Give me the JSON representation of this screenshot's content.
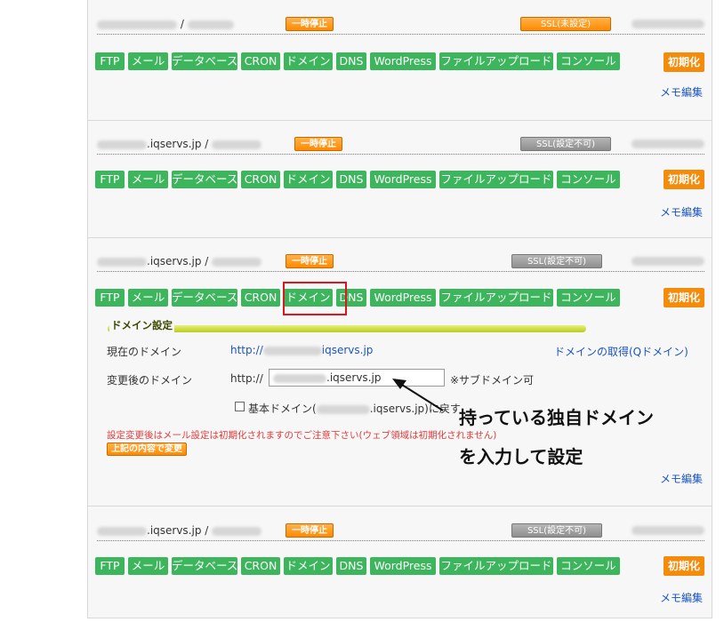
{
  "servers": [
    {
      "host_suffix": "",
      "pause": "一時停止",
      "ssl": "SSL(未設定)",
      "ssl_style": "orange"
    },
    {
      "host_suffix": ".iqservs.jp /",
      "pause": "一時停止",
      "ssl": "SSL(設定不可)",
      "ssl_style": "gray"
    },
    {
      "host_suffix": ".iqservs.jp /",
      "pause": "一時停止",
      "ssl": "SSL(設定不可)",
      "ssl_style": "gray"
    },
    {
      "host_suffix": ".iqservs.jp /",
      "pause": "一時停止",
      "ssl": "SSL(設定不可)",
      "ssl_style": "gray"
    }
  ],
  "first_host_sep": "/",
  "menu": [
    "FTP",
    "メール",
    "データベース",
    "CRON",
    "ドメイン",
    "DNS",
    "WordPress",
    "ファイルアップロード",
    "コンソール"
  ],
  "init_label": "初期化",
  "memo_label": "メモ編集",
  "domain_panel": {
    "title": "ドメイン設定",
    "current_label": "現在のドメイン",
    "current_prefix": "http://",
    "current_suffix": "iqservs.jp",
    "acquire_link": "ドメインの取得(Qドメイン)",
    "new_label": "変更後のドメイン",
    "new_prefix": "http://",
    "new_input_value": ".iqservs.jp",
    "subdomain_note": "※サブドメイン可",
    "reset_label_prefix": "基本ドメイン(",
    "reset_label_suffix": ".iqservs.jp)に戻す",
    "warning": "設定変更後はメール設定は初期化されますのでご注意下さい(ウェブ領域は初期化されません)",
    "submit_label": "上記の内容で変更"
  },
  "callout": {
    "line1": "持っている独自ドメイン",
    "line2": "を入力して設定"
  },
  "colors": {
    "green": "#3cb55c",
    "orange": "#f58b0a",
    "link": "#1a55c2",
    "warn": "#e23b3b",
    "highlight": "#e0141a"
  }
}
